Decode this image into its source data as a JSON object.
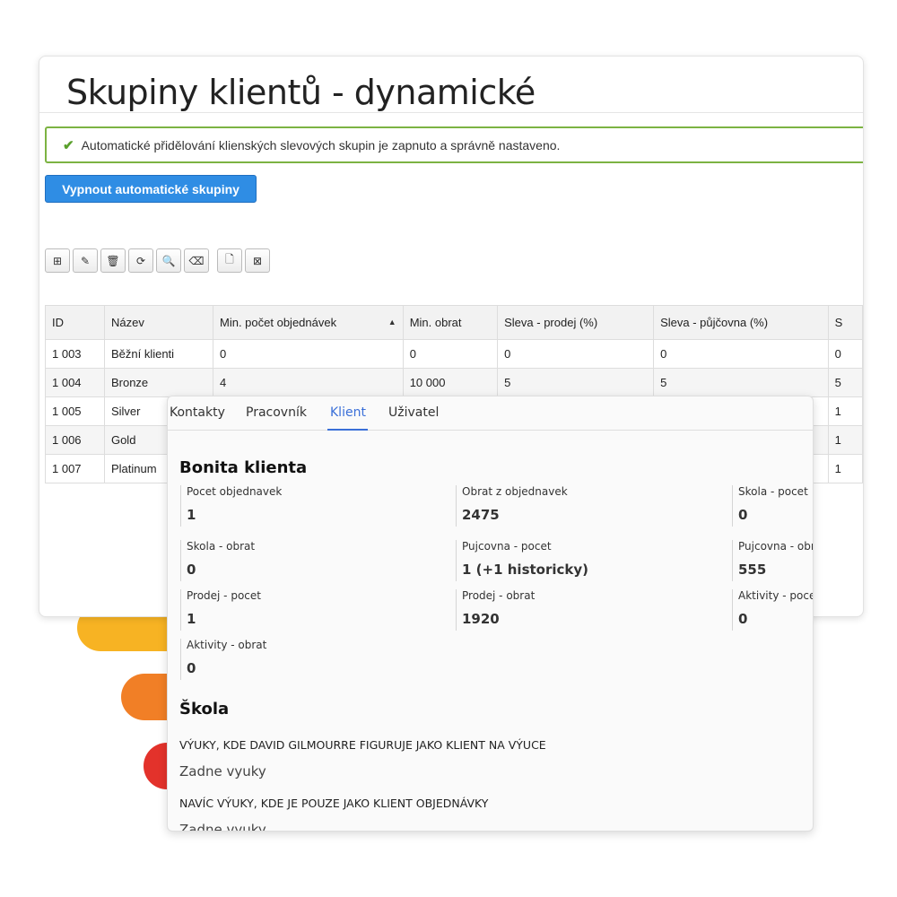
{
  "page": {
    "title": "Skupiny klientů - dynamické",
    "alert_text": "Automatické přidělování klienských slevových skupin je zapnuto a správně nastaveno.",
    "primary_button": "Vypnout automatické skupiny"
  },
  "toolbar": {
    "icons": [
      "add-icon",
      "edit-icon",
      "delete-icon",
      "refresh-icon",
      "search-icon",
      "eraser-icon",
      "file-icon",
      "excel-icon"
    ]
  },
  "table": {
    "columns": [
      "ID",
      "Název",
      "Min. počet objednávek",
      "Min. obrat",
      "Sleva - prodej (%)",
      "Sleva - půjčovna (%)",
      "S"
    ],
    "rows": [
      [
        "1 003",
        "Běžní klienti",
        "0",
        "0",
        "0",
        "0",
        "0"
      ],
      [
        "1 004",
        "Bronze",
        "4",
        "10 000",
        "5",
        "5",
        "5"
      ],
      [
        "1 005",
        "Silver",
        "",
        "",
        "",
        "",
        "1"
      ],
      [
        "1 006",
        "Gold",
        "",
        "",
        "",
        "",
        "1"
      ],
      [
        "1 007",
        "Platinum",
        "",
        "",
        "",
        "",
        "1"
      ]
    ]
  },
  "panel": {
    "tabs": [
      "Kontakty",
      "Pracovník",
      "Klient",
      "Uživatel"
    ],
    "active_tab": "Klient",
    "bonita_title": "Bonita klienta",
    "stats": [
      {
        "label": "Pocet objednavek",
        "value": "1"
      },
      {
        "label": "Obrat z objednavek",
        "value": "2475"
      },
      {
        "label": "Skola - pocet",
        "value": "0"
      },
      {
        "label": "Skola - obrat",
        "value": "0"
      },
      {
        "label": "Pujcovna - pocet",
        "value": "1 (+1 historicky)"
      },
      {
        "label": "Pujcovna - obra",
        "value": "555"
      },
      {
        "label": "Prodej - pocet",
        "value": "1"
      },
      {
        "label": "Prodej - obrat",
        "value": "1920"
      },
      {
        "label": "Aktivity - pocet",
        "value": "0"
      },
      {
        "label": "Aktivity - obrat",
        "value": "0"
      }
    ],
    "skola_title": "Škola",
    "skola_heading1": "VÝUKY, KDE DAVID GILMOURRE FIGURUJE JAKO KLIENT NA VÝUCE",
    "skola_text1": "Zadne vyuky",
    "skola_heading2": "NAVÍC VÝUKY, KDE JE POUZE JAKO KLIENT OBJEDNÁVKY",
    "skola_text2": "Zadne vyuky"
  },
  "colors": {
    "primary": "#2f8de4",
    "success": "#7cb342",
    "active_tab": "#3a6fd8",
    "pill_yellow": "#f7b323",
    "pill_orange": "#f17f26",
    "pill_red": "#e3322b"
  }
}
